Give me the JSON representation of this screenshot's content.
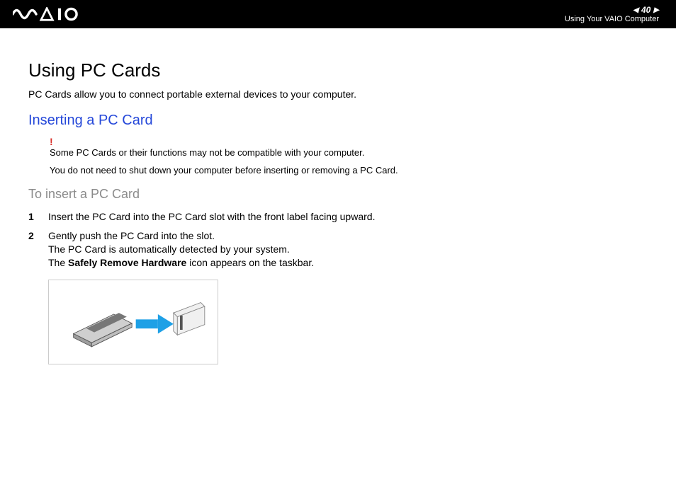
{
  "header": {
    "page_number": "40",
    "breadcrumb": "Using Your VAIO Computer"
  },
  "title": "Using PC Cards",
  "intro": "PC Cards allow you to connect portable external devices to your computer.",
  "section_heading": "Inserting a PC Card",
  "notice": {
    "line1": "Some PC Cards or their functions may not be compatible with your computer.",
    "line2": "You do not need to shut down your computer before inserting or removing a PC Card."
  },
  "subheading": "To insert a PC Card",
  "steps": {
    "s1": "Insert the PC Card into the PC Card slot with the front label facing upward.",
    "s2a": "Gently push the PC Card into the slot.",
    "s2b": "The PC Card is automatically detected by your system.",
    "s2c_pre": "The ",
    "s2c_bold": "Safely Remove Hardware",
    "s2c_post": " icon appears on the taskbar."
  }
}
